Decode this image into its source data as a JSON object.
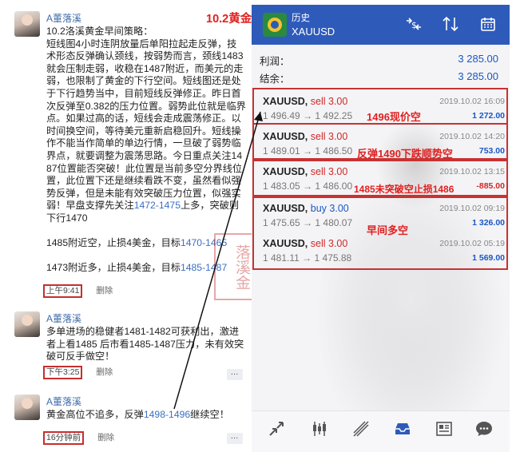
{
  "annotation_title": "10.2黄金",
  "chat": {
    "posts": [
      {
        "author": "A董落溪",
        "body_main": "10.2洛溪黄金早间策略：\n短线图4小时连阴放量后单阳拉起走反弹，技术形态反弹确认颈线，按弱势而言，颈线1483就会压制走弱，收稳在1487附近，而美元的走弱，也限制了黄金的下行空间。短线图还是处于下行趋势当中，目前短线反弹修正。昨日首次反弹至0.382的压力位置。弱势此位就是临界点。如果过高的话，短线会走成震荡修正。以时间换空间，等待美元重新启稳回升。短线操作不能当作简单的单边行情，一旦破了弱势临界点，就要调整为震荡思路。今日重点关注1487位置能否突破！此位置是当前多空分界线位置，此位置下还是继续看跌不变，虽然看似强势反弹，但是未能有效突破压力位置，似强实弱！早盘支撑先关注",
        "link1": "1472-1475",
        "body_tail1": "上多，突破则下行1470",
        "line2_pre": "1485附近空，止损4美金，目标",
        "link2": "1470-1465",
        "line3_pre": "1473附近多，止损4美金，目标",
        "link3": "1485-1487",
        "time": "上午9:41",
        "delete": "删除"
      },
      {
        "author": "A董落溪",
        "body": "多单进场的稳健者1481-1482可获利出，激进者上看1485 后市看1485-1487压力，未有效突破可反手做空！",
        "time": "下午3:25",
        "delete": "删除"
      },
      {
        "author": "A董落溪",
        "body_pre": "黄金高位不追多，反弹",
        "link": "1498-1496",
        "body_post": "继续空！",
        "time": "16分钟前",
        "delete": "删除"
      }
    ],
    "more_icon": "…"
  },
  "watermark_seal": "落溪金",
  "phone": {
    "header": {
      "subtitle": "历史",
      "symbol": "XAUUSD"
    },
    "summary": [
      {
        "label": "利润：",
        "value": "3 285.00"
      },
      {
        "label": "结余：",
        "value": "3 285.00"
      }
    ],
    "trades": [
      {
        "symbol": "XAUUSD,",
        "side": "sell",
        "lots": "3.00",
        "price_open": "1 496.49",
        "price_close": "1 492.25",
        "date": "2019.10.02 16:09",
        "pnl": "1 272.00",
        "pnl_sign": "pos",
        "note": "1496现价空"
      },
      {
        "symbol": "XAUUSD,",
        "side": "sell",
        "lots": "3.00",
        "price_open": "1 489.01",
        "price_close": "1 486.50",
        "date": "2019.10.02 14:20",
        "pnl": "753.00",
        "pnl_sign": "pos",
        "note": "反弹1490下跌顺势空"
      },
      {
        "symbol": "XAUUSD,",
        "side": "sell",
        "lots": "3.00",
        "price_open": "1 483.05",
        "price_close": "1 486.00",
        "date": "2019.10.02 13:15",
        "pnl": "-885.00",
        "pnl_sign": "neg",
        "note": "1485未突破空止损1486"
      },
      {
        "symbol": "XAUUSD,",
        "side": "buy",
        "lots": "3.00",
        "price_open": "1 475.65",
        "price_close": "1 480.07",
        "date": "2019.10.02 09:19",
        "pnl": "1 326.00",
        "pnl_sign": "pos",
        "note": ""
      },
      {
        "symbol": "XAUUSD,",
        "side": "sell",
        "lots": "3.00",
        "price_open": "1 481.11",
        "price_close": "1 475.88",
        "date": "2019.10.02 05:19",
        "pnl": "1 569.00",
        "pnl_sign": "pos",
        "note": ""
      }
    ],
    "group_note": "早间多空",
    "arrow": "→"
  },
  "colors": {
    "appbar": "#2e5bba",
    "accent_red": "#e02020",
    "profit_blue": "#1b57c4",
    "loss_red": "#d02828"
  }
}
